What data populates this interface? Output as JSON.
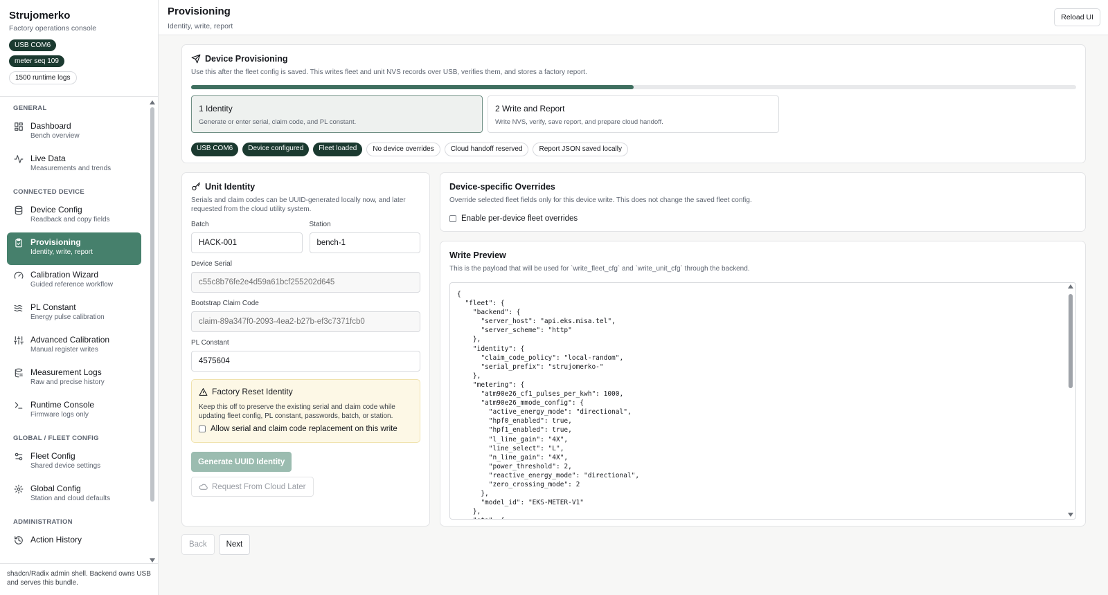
{
  "app": {
    "title": "Strujomerko",
    "subtitle": "Factory operations console",
    "status_chips": [
      "USB COM6",
      "meter seq 109",
      "1500 runtime logs"
    ],
    "footer": "shadcn/Radix admin shell. Backend owns USB and serves this bundle."
  },
  "sidebar": {
    "sections": [
      {
        "label": "GENERAL",
        "items": [
          {
            "title": "Dashboard",
            "sub": "Bench overview",
            "icon": "grid-icon"
          },
          {
            "title": "Live Data",
            "sub": "Measurements and trends",
            "icon": "activity-icon"
          }
        ]
      },
      {
        "label": "CONNECTED DEVICE",
        "items": [
          {
            "title": "Device Config",
            "sub": "Readback and copy fields",
            "icon": "database-icon"
          },
          {
            "title": "Provisioning",
            "sub": "Identity, write, report",
            "icon": "clipboard-check-icon",
            "active": true
          },
          {
            "title": "Calibration Wizard",
            "sub": "Guided reference workflow",
            "icon": "gauge-icon"
          },
          {
            "title": "PL Constant",
            "sub": "Energy pulse calibration",
            "icon": "waves-icon"
          },
          {
            "title": "Advanced Calibration",
            "sub": "Manual register writes",
            "icon": "sliders-icon"
          },
          {
            "title": "Measurement Logs",
            "sub": "Raw and precise history",
            "icon": "log-icon"
          },
          {
            "title": "Runtime Console",
            "sub": "Firmware logs only",
            "icon": "terminal-icon"
          }
        ]
      },
      {
        "label": "GLOBAL / FLEET CONFIG",
        "items": [
          {
            "title": "Fleet Config",
            "sub": "Shared device settings",
            "icon": "settings-2-icon"
          },
          {
            "title": "Global Config",
            "sub": "Station and cloud defaults",
            "icon": "gear-icon"
          }
        ]
      },
      {
        "label": "ADMINISTRATION",
        "items": [
          {
            "title": "Action History",
            "sub": "",
            "icon": "history-icon"
          }
        ]
      }
    ]
  },
  "header": {
    "title": "Provisioning",
    "subtitle": "Identity, write, report",
    "reload_label": "Reload UI"
  },
  "provisioning": {
    "title": "Device Provisioning",
    "description": "Use this after the fleet config is saved. This writes fleet and unit NVS records over USB, verifies them, and stores a factory report.",
    "progress_fraction": 0.5,
    "steps": [
      {
        "title": "1  Identity",
        "desc": "Generate or enter serial, claim code, and PL constant.",
        "active": true
      },
      {
        "title": "2  Write and Report",
        "desc": "Write NVS, verify, save report, and prepare cloud handoff.",
        "active": false
      }
    ],
    "badges": [
      {
        "label": "USB COM6",
        "style": "dark"
      },
      {
        "label": "Device configured",
        "style": "dark"
      },
      {
        "label": "Fleet loaded",
        "style": "dark"
      },
      {
        "label": "No device overrides",
        "style": "light"
      },
      {
        "label": "Cloud handoff reserved",
        "style": "light"
      },
      {
        "label": "Report JSON saved locally",
        "style": "light"
      }
    ]
  },
  "unit_identity": {
    "title": "Unit Identity",
    "description": "Serials and claim codes can be UUID-generated locally now, and later requested from the cloud utility system.",
    "batch_label": "Batch",
    "batch_value": "HACK-001",
    "station_label": "Station",
    "station_value": "bench-1",
    "serial_label": "Device Serial",
    "serial_placeholder": "c55c8b76fe2e4d59a61bcf255202d645",
    "claim_label": "Bootstrap Claim Code",
    "claim_placeholder": "claim-89a347f0-2093-4ea2-b27b-ef3c7371fcb0",
    "pl_label": "PL Constant",
    "pl_value": "4575604",
    "warning_title": "Factory Reset Identity",
    "warning_desc": "Keep this off to preserve the existing serial and claim code while updating fleet config, PL constant, passwords, batch, or station.",
    "warning_check": "Allow serial and claim code replacement on this write",
    "generate_label": "Generate UUID Identity",
    "cloud_label": "Request From Cloud Later"
  },
  "overrides": {
    "title": "Device-specific Overrides",
    "description": "Override selected fleet fields only for this device write. This does not change the saved fleet config.",
    "check_label": "Enable per-device fleet overrides"
  },
  "preview": {
    "title": "Write Preview",
    "description": "This is the payload that will be used for `write_fleet_cfg` and `write_unit_cfg` through the backend.",
    "code": "{\n  \"fleet\": {\n    \"backend\": {\n      \"server_host\": \"api.eks.misa.tel\",\n      \"server_scheme\": \"http\"\n    },\n    \"identity\": {\n      \"claim_code_policy\": \"local-random\",\n      \"serial_prefix\": \"strujomerko-\"\n    },\n    \"metering\": {\n      \"atm90e26_cf1_pulses_per_kwh\": 1000,\n      \"atm90e26_mmode_config\": {\n        \"active_energy_mode\": \"directional\",\n        \"hpf0_enabled\": true,\n        \"hpf1_enabled\": true,\n        \"l_line_gain\": \"4X\",\n        \"line_select\": \"L\",\n        \"n_line_gain\": \"4X\",\n        \"power_threshold\": 2,\n        \"reactive_energy_mode\": \"directional\",\n        \"zero_crossing_mode\": 2\n      },\n      \"model_id\": \"EKS-METER-V1\"\n    },\n    \"ota\": {"
  },
  "footer_nav": {
    "back_label": "Back",
    "next_label": "Next"
  }
}
